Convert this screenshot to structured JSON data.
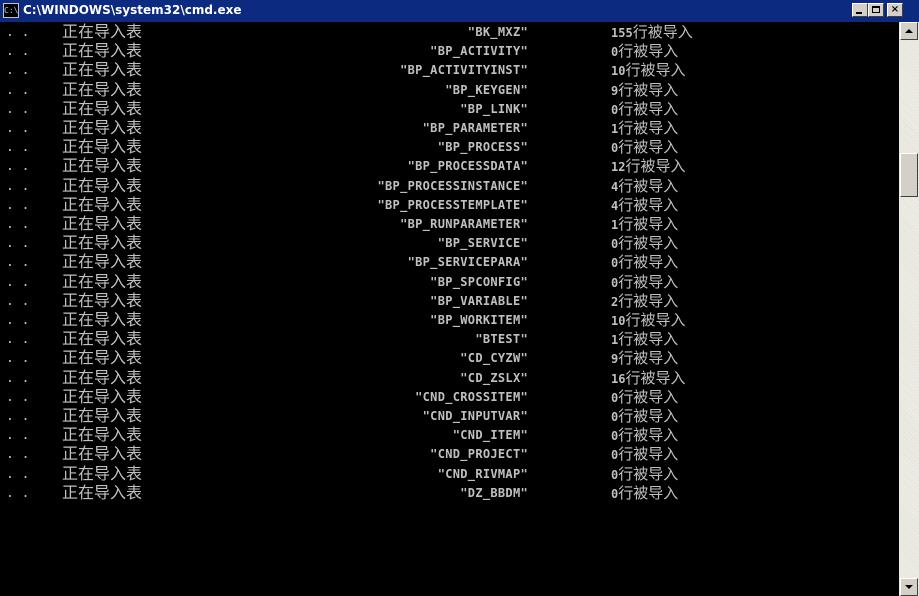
{
  "window": {
    "title": "C:\\WINDOWS\\system32\\cmd.exe",
    "icon_text": "C:\\",
    "controls": {
      "minimize": "_",
      "maximize": "□",
      "close": "×"
    }
  },
  "console": {
    "prefix": ". .",
    "message": "正在导入表",
    "suffix": "行被导入",
    "rows": [
      {
        "table": "\"BK_MXZ\"",
        "count": "155"
      },
      {
        "table": "\"BP_ACTIVITY\"",
        "count": "0"
      },
      {
        "table": "\"BP_ACTIVITYINST\"",
        "count": "10"
      },
      {
        "table": "\"BP_KEYGEN\"",
        "count": "9"
      },
      {
        "table": "\"BP_LINK\"",
        "count": "0"
      },
      {
        "table": "\"BP_PARAMETER\"",
        "count": "1"
      },
      {
        "table": "\"BP_PROCESS\"",
        "count": "0"
      },
      {
        "table": "\"BP_PROCESSDATA\"",
        "count": "12"
      },
      {
        "table": "\"BP_PROCESSINSTANCE\"",
        "count": "4"
      },
      {
        "table": "\"BP_PROCESSTEMPLATE\"",
        "count": "4"
      },
      {
        "table": "\"BP_RUNPARAMETER\"",
        "count": "1"
      },
      {
        "table": "\"BP_SERVICE\"",
        "count": "0"
      },
      {
        "table": "\"BP_SERVICEPARA\"",
        "count": "0"
      },
      {
        "table": "\"BP_SPCONFIG\"",
        "count": "0"
      },
      {
        "table": "\"BP_VARIABLE\"",
        "count": "2"
      },
      {
        "table": "\"BP_WORKITEM\"",
        "count": "10"
      },
      {
        "table": "\"BTEST\"",
        "count": "1"
      },
      {
        "table": "\"CD_CYZW\"",
        "count": "9"
      },
      {
        "table": "\"CD_ZSLX\"",
        "count": "16"
      },
      {
        "table": "\"CND_CROSSITEM\"",
        "count": "0"
      },
      {
        "table": "\"CND_INPUTVAR\"",
        "count": "0"
      },
      {
        "table": "\"CND_ITEM\"",
        "count": "0"
      },
      {
        "table": "\"CND_PROJECT\"",
        "count": "0"
      },
      {
        "table": "\"CND_RIVMAP\"",
        "count": "0"
      },
      {
        "table": "\"DZ_BBDM\"",
        "count": "0"
      }
    ]
  },
  "scrollbar": {
    "position_fraction": 0.24
  },
  "colors": {
    "console_bg": "#000000",
    "console_text": "#c0c0c0",
    "titlebar": "#0b2a80"
  }
}
